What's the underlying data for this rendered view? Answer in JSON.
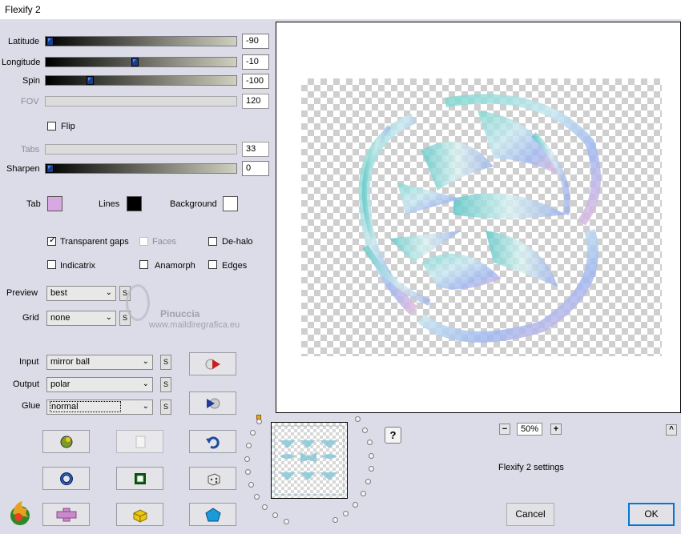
{
  "window": {
    "title": "Flexify 2"
  },
  "sliders": {
    "latitude": {
      "label": "Latitude",
      "value": "-90",
      "level": 0.0
    },
    "longitude": {
      "label": "Longitude",
      "value": "-10",
      "level": 0.47
    },
    "spin": {
      "label": "Spin",
      "value": "-100",
      "level": 0.22
    },
    "fov": {
      "label": "FOV",
      "value": "120",
      "enabled": false
    },
    "tabs": {
      "label": "Tabs",
      "value": "33",
      "enabled": false
    },
    "sharpen": {
      "label": "Sharpen",
      "value": "0",
      "level": 0.0
    }
  },
  "flip": {
    "label": "Flip",
    "checked": false
  },
  "colors": {
    "tab": {
      "label": "Tab",
      "color": "#d8a8e0"
    },
    "lines": {
      "label": "Lines",
      "color": "#000000"
    },
    "background": {
      "label": "Background",
      "color": "#ffffff"
    }
  },
  "options": {
    "transparent_gaps": {
      "label": "Transparent gaps",
      "checked": true
    },
    "faces": {
      "label": "Faces",
      "checked": false,
      "enabled": false
    },
    "de_halo": {
      "label": "De-halo",
      "checked": false
    },
    "indicatrix": {
      "label": "Indicatrix",
      "checked": false
    },
    "anamorph": {
      "label": "Anamorph",
      "checked": false
    },
    "edges": {
      "label": "Edges",
      "checked": false
    }
  },
  "preview": {
    "label": "Preview",
    "value": "best"
  },
  "grid": {
    "label": "Grid",
    "value": "none"
  },
  "input": {
    "label": "Input",
    "value": "mirror ball"
  },
  "output": {
    "label": "Output",
    "value": "polar"
  },
  "glue": {
    "label": "Glue",
    "value": "normal"
  },
  "s_glyph": "S",
  "watermark": {
    "name": "Pinuccia",
    "site": "www.maildiregrafica.eu"
  },
  "zoom": {
    "minus": "−",
    "value": "50%",
    "plus": "+"
  },
  "help_glyph": "?",
  "collapse_glyph": "^",
  "settings_label": "Flexify 2 settings",
  "buttons": {
    "cancel": "Cancel",
    "ok": "OK"
  },
  "accent": "#0078d7"
}
